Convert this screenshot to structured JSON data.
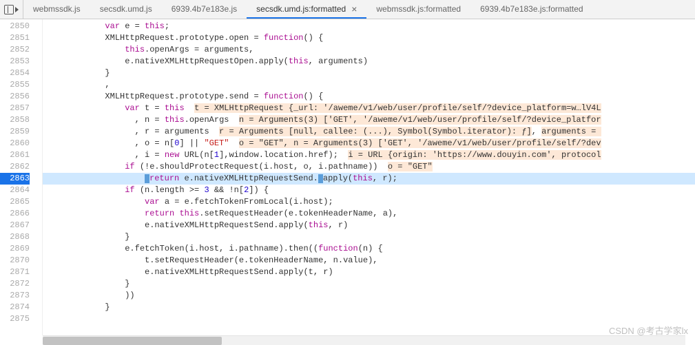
{
  "toolbar": {
    "panel_icon": "panel-toggle-icon",
    "chevron_icon": "chevron-right-icon"
  },
  "tabs": [
    {
      "label": "webmssdk.js",
      "active": false,
      "closable": false
    },
    {
      "label": "secsdk.umd.js",
      "active": false,
      "closable": false
    },
    {
      "label": "6939.4b7e183e.js",
      "active": false,
      "closable": false
    },
    {
      "label": "secsdk.umd.js:formatted",
      "active": true,
      "closable": true
    },
    {
      "label": "webmssdk.js:formatted",
      "active": false,
      "closable": false
    },
    {
      "label": "6939.4b7e183e.js:formatted",
      "active": false,
      "closable": false
    }
  ],
  "line_start": 2850,
  "line_end": 2875,
  "execution_line": 2863,
  "code_lines": {
    "2850": {
      "indent": 12,
      "tokens": [
        [
          "kw",
          "var"
        ],
        [
          "pl",
          " e = "
        ],
        [
          "kw",
          "this"
        ],
        [
          "pl",
          ";"
        ]
      ]
    },
    "2851": {
      "indent": 12,
      "tokens": [
        [
          "pl",
          "XMLHttpRequest.prototype.open = "
        ],
        [
          "kw",
          "function"
        ],
        [
          "pl",
          "() {"
        ]
      ]
    },
    "2852": {
      "indent": 16,
      "tokens": [
        [
          "kw",
          "this"
        ],
        [
          "pl",
          ".openArgs = arguments,"
        ]
      ]
    },
    "2853": {
      "indent": 16,
      "tokens": [
        [
          "pl",
          "e.nativeXMLHttpRequestOpen.apply("
        ],
        [
          "kw",
          "this"
        ],
        [
          "pl",
          ", arguments)"
        ]
      ]
    },
    "2854": {
      "indent": 12,
      "tokens": [
        [
          "pl",
          "}"
        ]
      ]
    },
    "2855": {
      "indent": 12,
      "tokens": [
        [
          "pl",
          ","
        ]
      ]
    },
    "2856": {
      "indent": 12,
      "tokens": [
        [
          "pl",
          "XMLHttpRequest.prototype.send = "
        ],
        [
          "kw",
          "function"
        ],
        [
          "pl",
          "() {"
        ]
      ]
    },
    "2857": {
      "indent": 16,
      "tokens": [
        [
          "kw",
          "var"
        ],
        [
          "pl",
          " t = "
        ],
        [
          "kw",
          "this"
        ],
        [
          "pl",
          "  "
        ],
        [
          "inline",
          "t = XMLHttpRequest {_url: '/aweme/v1/web/user/profile/self/?device_platform=w…lV4L"
        ]
      ]
    },
    "2858": {
      "indent": 18,
      "tokens": [
        [
          "pl",
          ", n = "
        ],
        [
          "kw",
          "this"
        ],
        [
          "pl",
          ".openArgs  "
        ],
        [
          "inline",
          "n = Arguments(3) ['GET', '/aweme/v1/web/user/profile/self/?device_platfor"
        ]
      ]
    },
    "2859": {
      "indent": 18,
      "tokens": [
        [
          "pl",
          ", r = arguments  "
        ],
        [
          "inline",
          "r = Arguments [null, callee: (...), Symbol(Symbol.iterator): ƒ]"
        ],
        [
          "pl",
          ", "
        ],
        [
          "inline",
          "arguments = "
        ]
      ]
    },
    "2860": {
      "indent": 18,
      "tokens": [
        [
          "pl",
          ", o = n["
        ],
        [
          "num",
          "0"
        ],
        [
          "pl",
          "] || "
        ],
        [
          "str",
          "\"GET\""
        ],
        [
          "pl",
          "  "
        ],
        [
          "inline",
          "o = \"GET\", n = Arguments(3) ['GET', '/aweme/v1/web/user/profile/self/?dev"
        ]
      ]
    },
    "2861": {
      "indent": 18,
      "tokens": [
        [
          "pl",
          ", i = "
        ],
        [
          "kw",
          "new"
        ],
        [
          "pl",
          " URL(n["
        ],
        [
          "num",
          "1"
        ],
        [
          "pl",
          "],window.location.href);  "
        ],
        [
          "inline",
          "i = URL {origin: 'https://www.douyin.com', protocol"
        ]
      ]
    },
    "2862": {
      "indent": 16,
      "tokens": [
        [
          "kw",
          "if"
        ],
        [
          "pl",
          " (!e.shouldProtectRequest(i.host, o, i.pathname))  "
        ],
        [
          "inline",
          "o = \"GET\""
        ]
      ]
    },
    "2863": {
      "indent": 20,
      "tokens": [
        [
          "cursor",
          ""
        ],
        [
          "kw",
          "return"
        ],
        [
          "pl",
          " e.nativeXMLHttpRequestSend."
        ],
        [
          "cursor",
          ""
        ],
        [
          "pl",
          "apply("
        ],
        [
          "kw",
          "this"
        ],
        [
          "pl",
          ", r);"
        ]
      ],
      "current": true
    },
    "2864": {
      "indent": 16,
      "tokens": [
        [
          "kw",
          "if"
        ],
        [
          "pl",
          " (n.length >= "
        ],
        [
          "num",
          "3"
        ],
        [
          "pl",
          " && !n["
        ],
        [
          "num",
          "2"
        ],
        [
          "pl",
          "]) {"
        ]
      ]
    },
    "2865": {
      "indent": 20,
      "tokens": [
        [
          "kw",
          "var"
        ],
        [
          "pl",
          " a = e.fetchTokenFromLocal(i.host);"
        ]
      ]
    },
    "2866": {
      "indent": 20,
      "tokens": [
        [
          "kw",
          "return"
        ],
        [
          "pl",
          " "
        ],
        [
          "kw",
          "this"
        ],
        [
          "pl",
          ".setRequestHeader(e.tokenHeaderName, a),"
        ]
      ]
    },
    "2867": {
      "indent": 20,
      "tokens": [
        [
          "pl",
          "e.nativeXMLHttpRequestSend.apply("
        ],
        [
          "kw",
          "this"
        ],
        [
          "pl",
          ", r)"
        ]
      ]
    },
    "2868": {
      "indent": 16,
      "tokens": [
        [
          "pl",
          "}"
        ]
      ]
    },
    "2869": {
      "indent": 16,
      "tokens": [
        [
          "pl",
          "e.fetchToken(i.host, i.pathname).then(("
        ],
        [
          "kw",
          "function"
        ],
        [
          "pl",
          "(n) {"
        ]
      ]
    },
    "2870": {
      "indent": 20,
      "tokens": [
        [
          "pl",
          "t.setRequestHeader(e.tokenHeaderName, n.value),"
        ]
      ]
    },
    "2871": {
      "indent": 20,
      "tokens": [
        [
          "pl",
          "e.nativeXMLHttpRequestSend.apply(t, r)"
        ]
      ]
    },
    "2872": {
      "indent": 16,
      "tokens": [
        [
          "pl",
          "}"
        ]
      ]
    },
    "2873": {
      "indent": 16,
      "tokens": [
        [
          "pl",
          "))"
        ]
      ]
    },
    "2874": {
      "indent": 12,
      "tokens": [
        [
          "pl",
          "}"
        ]
      ]
    },
    "2875": {
      "indent": 0,
      "tokens": []
    }
  },
  "watermark": "CSDN @考古学家lx"
}
